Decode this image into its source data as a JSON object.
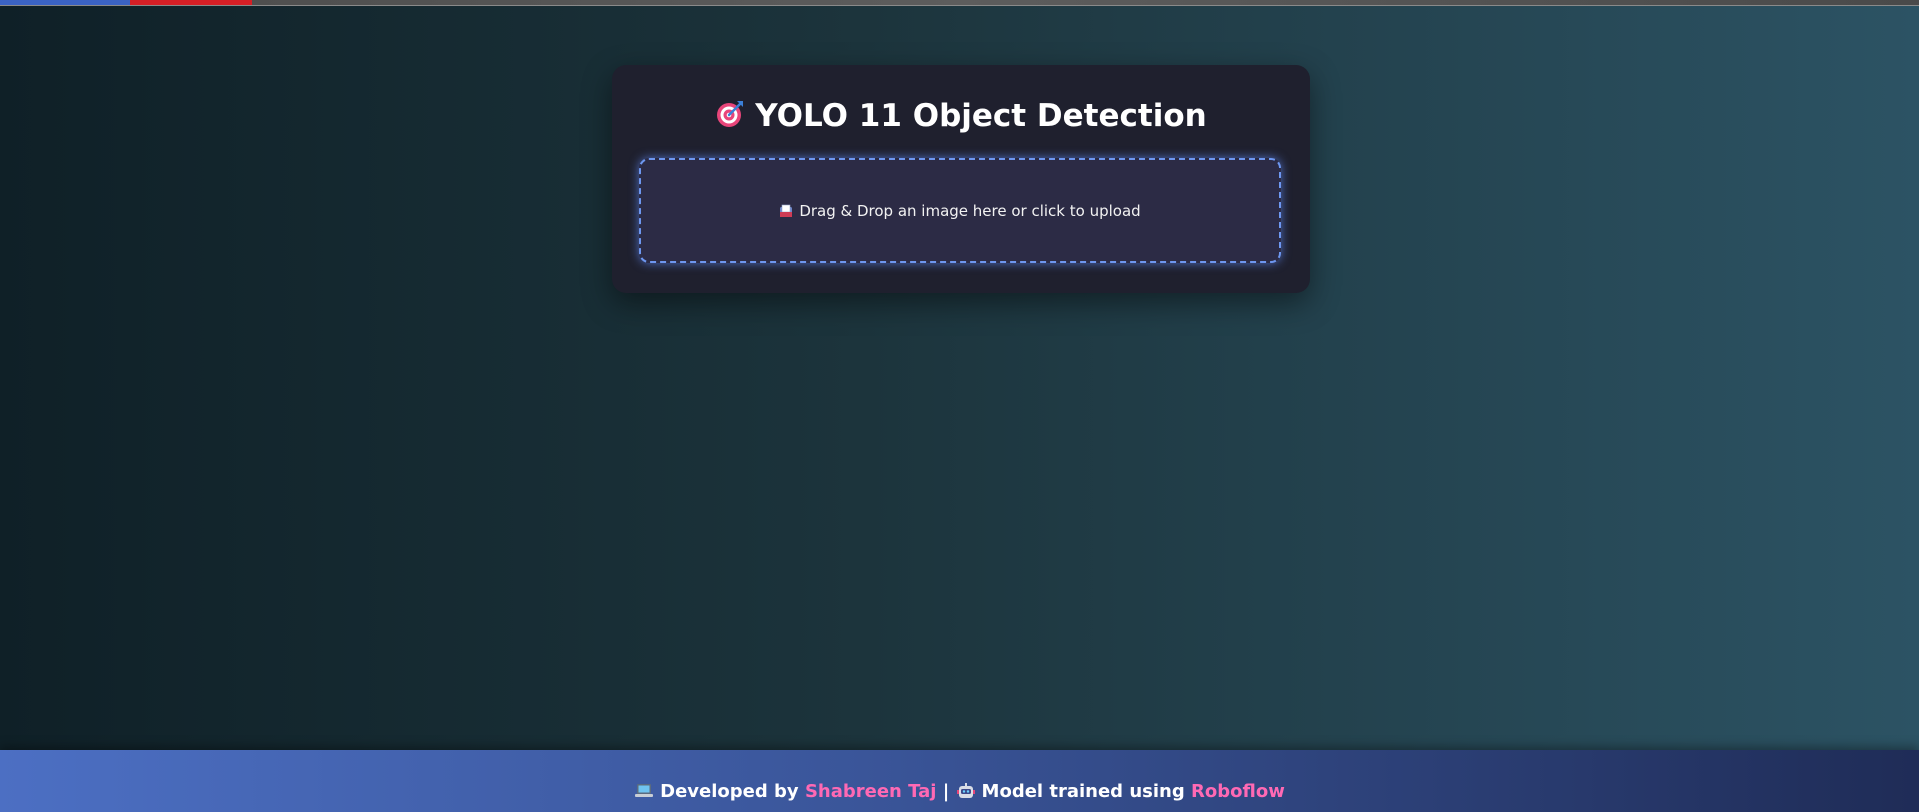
{
  "colors": {
    "accent": "#ff69b4",
    "card_bg": "#1f202e",
    "drop_border": "#6e97f0"
  },
  "header": {
    "title_icon": "target-icon",
    "title": "YOLO 11 Object Detection"
  },
  "upload": {
    "icon": "inbox-icon",
    "label": "Drag & Drop an image here or click to upload"
  },
  "footer": {
    "laptop_icon": "laptop-icon",
    "developed_by": "Developed by",
    "author": "Shabreen Taj",
    "separator": "|",
    "robot_icon": "robot-icon",
    "model_trained": "Model trained using",
    "platform": "Roboflow"
  }
}
